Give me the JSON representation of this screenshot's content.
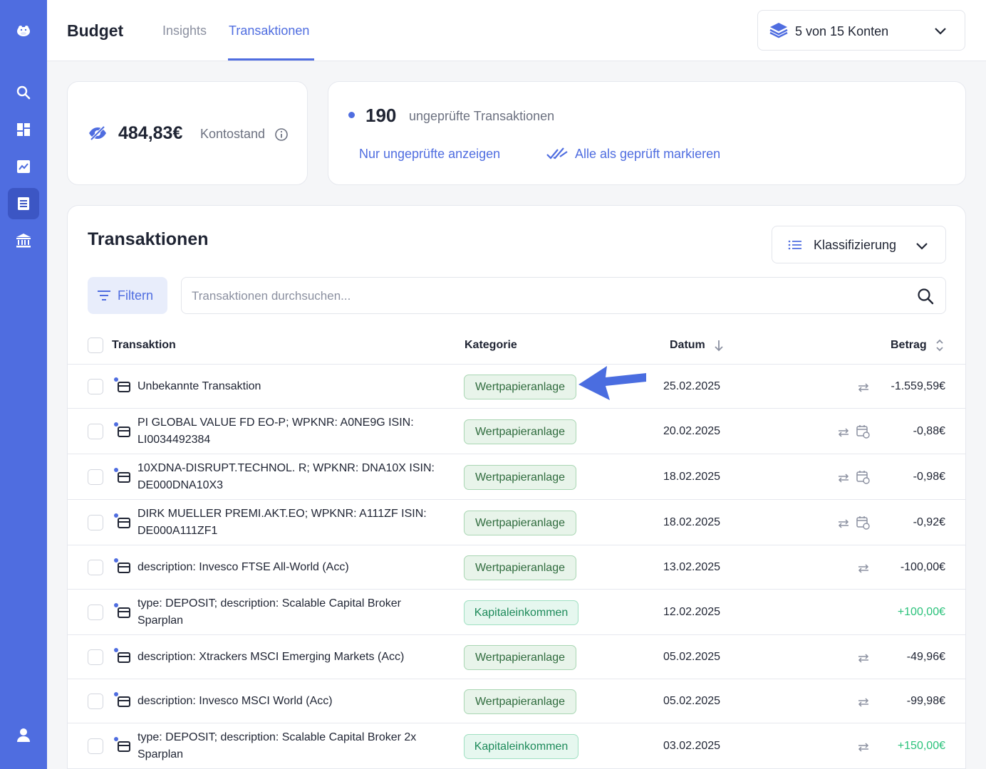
{
  "sidebar": {
    "icons": [
      "hippo-logo-icon",
      "search-icon",
      "dashboard-icon",
      "chart-icon",
      "transactions-icon",
      "bank-icon",
      "user-icon"
    ]
  },
  "header": {
    "brand": "Budget",
    "tabs": [
      {
        "label": "Insights",
        "active": false
      },
      {
        "label": "Transaktionen",
        "active": true
      }
    ],
    "accounts_label": "5 von 15 Konten"
  },
  "balance": {
    "amount": "484,83€",
    "label": "Kontostand"
  },
  "review": {
    "count": "190",
    "label": "ungeprüfte Transaktionen",
    "show_unreviewed": "Nur ungeprüfte anzeigen",
    "mark_all": "Alle als geprüft markieren"
  },
  "transactions": {
    "title": "Transaktionen",
    "classify_label": "Klassifizierung",
    "filter_label": "Filtern",
    "search_placeholder": "Transaktionen durchsuchen...",
    "columns": {
      "transaction": "Transaktion",
      "category": "Kategorie",
      "date": "Datum",
      "amount": "Betrag"
    },
    "rows": [
      {
        "desc": "Unbekannte Transaktion",
        "category": "Wertpapieranlage",
        "date": "25.02.2025",
        "amount": "-1.559,59€",
        "positive": false,
        "transfer": true,
        "recurring": false
      },
      {
        "desc": "PI GLOBAL VALUE FD EO-P; WPKNR: A0NE9G ISIN: LI0034492384",
        "category": "Wertpapieranlage",
        "date": "20.02.2025",
        "amount": "-0,88€",
        "positive": false,
        "transfer": true,
        "recurring": true
      },
      {
        "desc": "10XDNA-DISRUPT.TECHNOL. R; WPKNR: DNA10X ISIN: DE000DNA10X3",
        "category": "Wertpapieranlage",
        "date": "18.02.2025",
        "amount": "-0,98€",
        "positive": false,
        "transfer": true,
        "recurring": true
      },
      {
        "desc": "DIRK MUELLER PREMI.AKT.EO; WPKNR: A111ZF ISIN: DE000A111ZF1",
        "category": "Wertpapieranlage",
        "date": "18.02.2025",
        "amount": "-0,92€",
        "positive": false,
        "transfer": true,
        "recurring": true
      },
      {
        "desc": "description: Invesco FTSE All-World (Acc)",
        "category": "Wertpapieranlage",
        "date": "13.02.2025",
        "amount": "-100,00€",
        "positive": false,
        "transfer": true,
        "recurring": false
      },
      {
        "desc": "type: DEPOSIT; description: Scalable Capital Broker Sparplan",
        "category": "Kapitaleinkommen",
        "date": "12.02.2025",
        "amount": "+100,00€",
        "positive": true,
        "transfer": false,
        "recurring": false
      },
      {
        "desc": "description: Xtrackers MSCI Emerging Markets (Acc)",
        "category": "Wertpapieranlage",
        "date": "05.02.2025",
        "amount": "-49,96€",
        "positive": false,
        "transfer": true,
        "recurring": false
      },
      {
        "desc": "description: Invesco MSCI World (Acc)",
        "category": "Wertpapieranlage",
        "date": "05.02.2025",
        "amount": "-99,98€",
        "positive": false,
        "transfer": true,
        "recurring": false
      },
      {
        "desc": "type: DEPOSIT; description: Scalable Capital Broker 2x Sparplan",
        "category": "Kapitaleinkommen",
        "date": "03.02.2025",
        "amount": "+150,00€",
        "positive": true,
        "transfer": true,
        "recurring": false
      }
    ]
  },
  "colors": {
    "accent": "#4f6de0",
    "positive": "#2bc27b"
  }
}
